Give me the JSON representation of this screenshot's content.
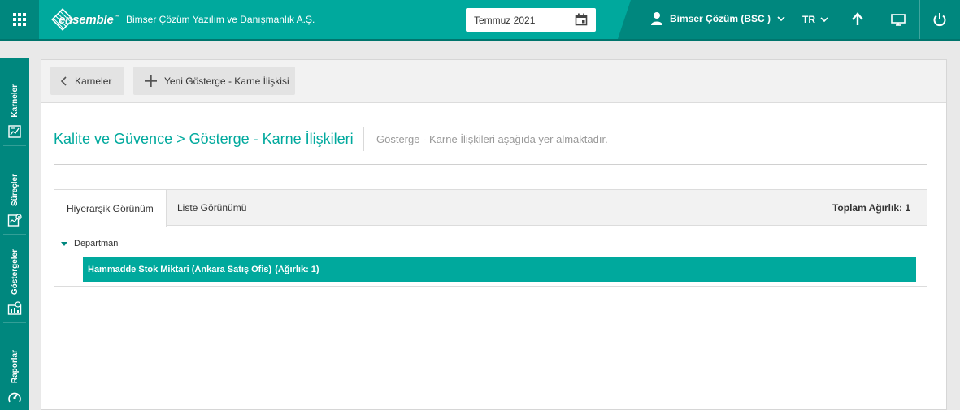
{
  "header": {
    "logo_text": "ensemble",
    "logo_tm": "™",
    "company": "Bimser Çözüm Yazılım ve Danışmanlık A.Ş.",
    "date": "Temmuz 2021",
    "user": "Bimser Çözüm (BSC )",
    "language": "TR"
  },
  "rail": {
    "items": [
      {
        "label": "Karneler",
        "icon": "scorecard-icon"
      },
      {
        "label": "Süreçler",
        "icon": "process-icon"
      },
      {
        "label": "Göstergeler",
        "icon": "indicator-icon"
      },
      {
        "label": "Raporlar",
        "icon": "report-icon"
      }
    ]
  },
  "toolbar": {
    "back_label": "Karneler",
    "new_label": "Yeni Gösterge - Karne İlişkisi"
  },
  "page": {
    "title": "Kalite ve Güvence > Gösterge - Karne İlişkileri",
    "description": "Gösterge - Karne İlişkileri aşağıda yer almaktadır."
  },
  "tabs": [
    {
      "label": "Hiyerarşik Görünüm",
      "active": true
    },
    {
      "label": "Liste Görünümü",
      "active": false
    }
  ],
  "total_weight": "Toplam Ağırlık: 1",
  "tree": {
    "node": "Departman",
    "leaf_text": "Hammadde Stok Miktari (Ankara Satış Ofis)",
    "leaf_weight": "(Ağırlık: 1)"
  },
  "colors": {
    "primary": "#00a99d",
    "primary_dark": "#00877e"
  }
}
